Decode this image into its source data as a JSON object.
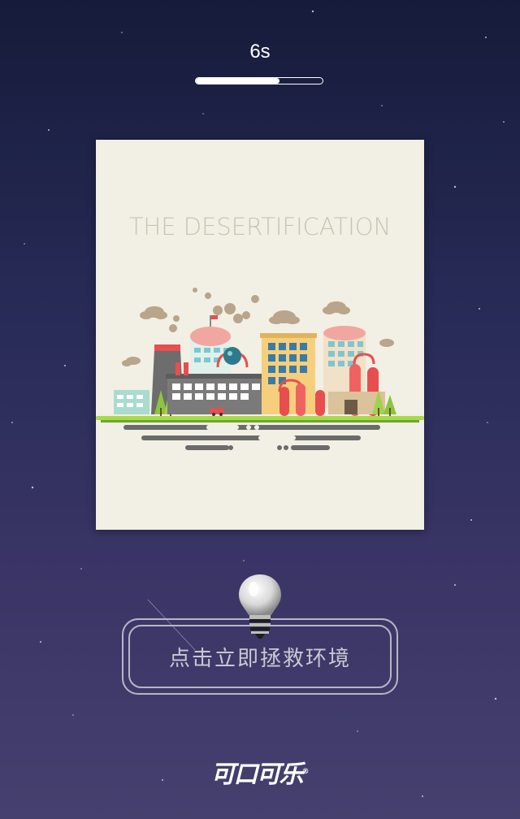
{
  "timer": {
    "label": "6s",
    "progress": 0.66
  },
  "card": {
    "title": "THE DESERTIFICATION",
    "illustration": "factory-city-illustration"
  },
  "cta": {
    "label": "点击立即拯救环境",
    "icon": "lightbulb-icon"
  },
  "brand": {
    "logo_text": "可口可乐",
    "mark": "®"
  },
  "colors": {
    "background_top": "#161b3a",
    "background_bottom": "#45406e",
    "card_bg": "#f2efe4",
    "title_text": "#c9c4b4",
    "button_stroke": "#b8b6c4"
  }
}
